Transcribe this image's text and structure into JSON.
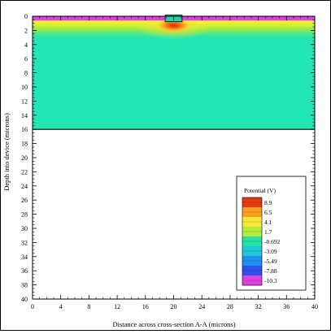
{
  "chart_data": {
    "type": "heatmap",
    "xlabel": "Distance across cross-section A-A (microns)",
    "ylabel": "Depth into device (microns)",
    "xlim": [
      0,
      40
    ],
    "ylim": [
      0,
      40
    ],
    "y_direction": "downward",
    "x_ticks": [
      "0",
      "4",
      "8",
      "12",
      "16",
      "20",
      "24",
      "28",
      "32",
      "36",
      "40"
    ],
    "y_ticks": [
      "0",
      "2",
      "4",
      "6",
      "8",
      "10",
      "12",
      "14",
      "16",
      "18",
      "20",
      "22",
      "24",
      "26",
      "28",
      "30",
      "32",
      "34",
      "36",
      "38",
      "40"
    ],
    "legend": {
      "title": "Potential (V)",
      "placement": "bottom-right",
      "entries": [
        {
          "label": "8.9",
          "color": "#e83a10"
        },
        {
          "label": "6.5",
          "color": "#f7a020"
        },
        {
          "label": "4.1",
          "color": "#f6e838"
        },
        {
          "label": "1.7",
          "color": "#b6ea3c"
        },
        {
          "label": "-0.692",
          "color": "#26e2a8"
        },
        {
          "label": "-3.09",
          "color": "#20c8d8"
        },
        {
          "label": "-5.49",
          "color": "#2090f0"
        },
        {
          "label": "-7.88",
          "color": "#3050e8"
        },
        {
          "label": "-10.3",
          "color": "#e040e0"
        }
      ]
    },
    "field": {
      "domain_x": [
        0,
        40
      ],
      "domain_depth": [
        0,
        16
      ],
      "background_value": -0.692,
      "background_color": "#22e6b4",
      "surface_layer": {
        "depth": [
          0.0,
          0.6
        ],
        "value": -10.3,
        "color": "#e040e0"
      },
      "gate_contact": {
        "x": [
          18.8,
          21.2
        ],
        "depth": [
          0.0,
          0.6
        ],
        "value": -0.692,
        "color": "#26d0b0"
      },
      "depletion_band": {
        "depth": [
          0.6,
          3.0
        ],
        "gradient": [
          {
            "depth": 0.6,
            "value": 4.1,
            "color": "#ffee30"
          },
          {
            "depth": 1.4,
            "value": 1.7,
            "color": "#ccee30"
          },
          {
            "depth": 2.2,
            "value": 0.5,
            "color": "#66e870"
          },
          {
            "depth": 3.0,
            "value": -0.692,
            "color": "#22e6b4"
          }
        ]
      },
      "peak": {
        "x": 20,
        "depth": 1.3,
        "value": 8.9,
        "color": "#e83a10"
      }
    }
  }
}
